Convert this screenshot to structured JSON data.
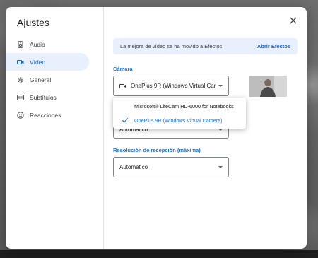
{
  "title": "Ajustes",
  "sidebar": {
    "items": [
      {
        "label": "Audio",
        "icon": "speaker-icon",
        "active": false
      },
      {
        "label": "Vídeo",
        "icon": "video-camera-icon",
        "active": true
      },
      {
        "label": "General",
        "icon": "gear-icon",
        "active": false
      },
      {
        "label": "Subtítulos",
        "icon": "captions-icon",
        "active": false
      },
      {
        "label": "Reacciones",
        "icon": "smiley-icon",
        "active": false
      }
    ]
  },
  "banner": {
    "message": "La mejora de vídeo se ha movido a Efectos",
    "action": "Abrir Efectos"
  },
  "camera": {
    "label": "Cámara",
    "selected": "OnePlus 9R (Windows Virtual Came...",
    "options": [
      {
        "label": "Microsoft® LifeCam HD-6000 for Notebooks",
        "selected": false
      },
      {
        "label": "OnePlus 9R (Windows Virtual Camera)",
        "selected": true
      }
    ]
  },
  "send_resolution": {
    "value_partial": "Automático"
  },
  "receive_resolution": {
    "label": "Resolución de recepción (máxima)",
    "value": "Automático"
  },
  "colors": {
    "accent": "#1a73e8",
    "active_nav_bg": "#e8f0fe",
    "banner_bg": "#e8f0fe"
  }
}
